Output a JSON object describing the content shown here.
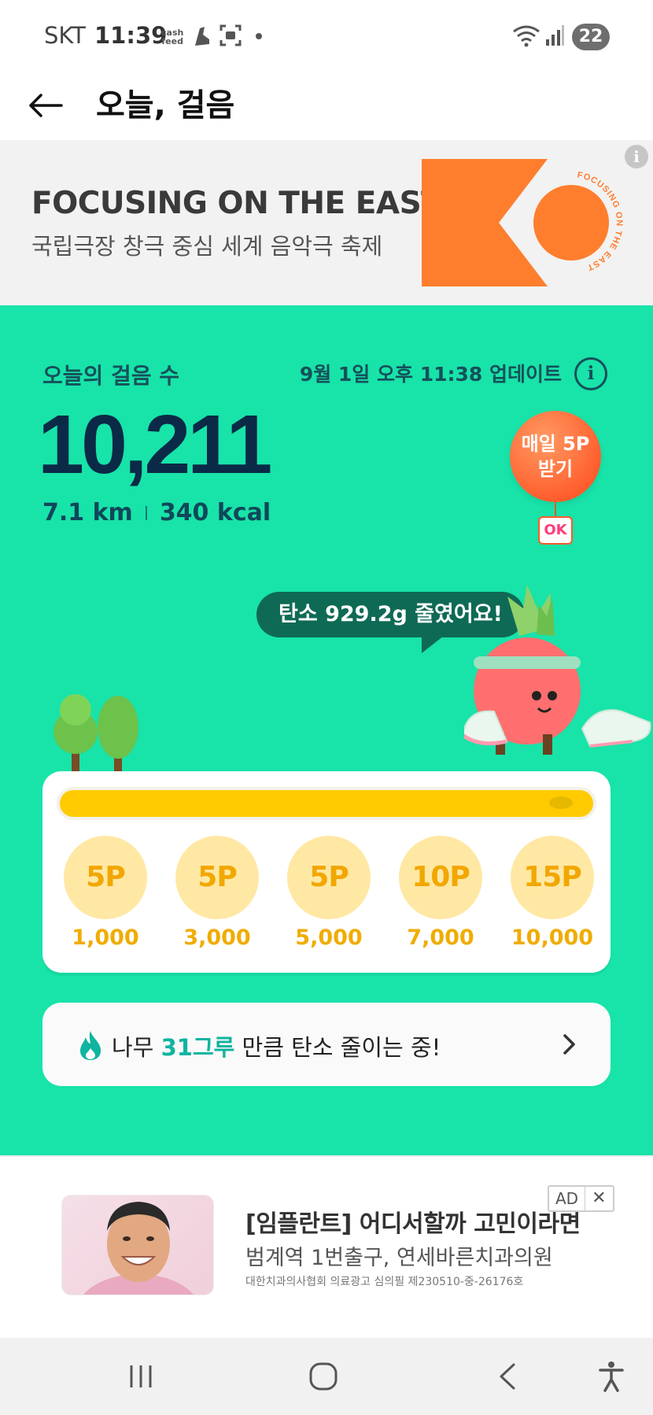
{
  "status_bar": {
    "carrier": "SKT",
    "time": "11:39",
    "cash_top": "cash",
    "cash_bottom": "feed",
    "battery": "22"
  },
  "header": {
    "title": "오늘, 걸음"
  },
  "banner": {
    "title": "FOCUSING ON THE EAST",
    "subtitle": "국립극장 창극 중심 세계 음악극 축제",
    "art_ring_text": "FOCUSING ON THE EAST",
    "info": "i",
    "colors": {
      "accent": "#fe7e2e"
    }
  },
  "steps": {
    "label": "오늘의 걸음 수",
    "updated": "9월 1일 오후 11:38 업데이트",
    "count": "10,211",
    "distance": "7.1 km",
    "calories": "340 kcal",
    "info": "i"
  },
  "daily_reward": {
    "line1": "매일 5P",
    "line2": "받기",
    "tag": "OK"
  },
  "carbon": {
    "message": "탄소 929.2g 줄였어요!"
  },
  "rewards": {
    "progress": 1.0,
    "items": [
      {
        "points": "5P",
        "steps": "1,000"
      },
      {
        "points": "5P",
        "steps": "3,000"
      },
      {
        "points": "5P",
        "steps": "5,000"
      },
      {
        "points": "10P",
        "steps": "7,000"
      },
      {
        "points": "15P",
        "steps": "10,000"
      }
    ]
  },
  "trees": {
    "prefix": "나무 ",
    "highlight": "31그루",
    "suffix": " 만큼 탄소 줄이는 중!"
  },
  "ad": {
    "title": "[임플란트] 어디서할까 고민이라면",
    "subtitle": "범계역 1번출구, 연세바른치과의원",
    "disclaimer": "대한치과의사협회 의료광고 심의필 제230510-중-26176호",
    "badge": "AD",
    "close": "✕"
  },
  "colors": {
    "green_bg": "#18e3a9",
    "progress": "#ffcb00",
    "reward_circle": "#ffe8a3",
    "highlight": "#10b4a0"
  }
}
